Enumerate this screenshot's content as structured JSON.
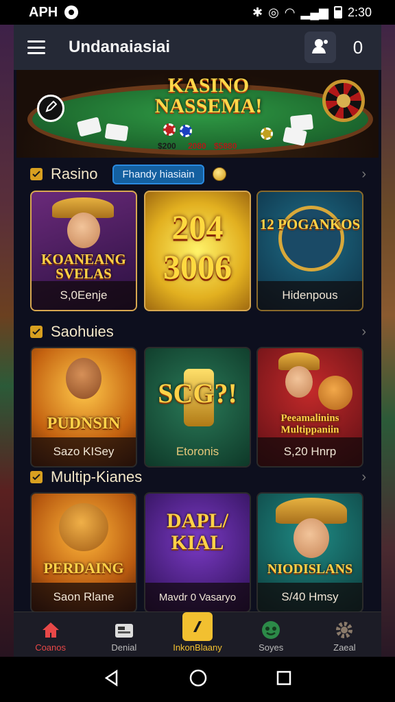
{
  "status_bar": {
    "carrier": "APH",
    "time": "2:30"
  },
  "header": {
    "title": "Undanaiasiai"
  },
  "banner": {
    "title_line1": "KASINO",
    "title_line2": "NASSEMA!",
    "amounts": [
      "$200",
      "2080",
      "$5880"
    ]
  },
  "sections": [
    {
      "title": "Rasino",
      "pill": "Fhandy hiasiain",
      "tiles": [
        {
          "big": "KOANEANG SVELAS",
          "sub": "S,0Eenje"
        },
        {
          "big": "204 3006",
          "sub": ""
        },
        {
          "big": "12 POGANKOS",
          "sub": "Hidenpous"
        }
      ]
    },
    {
      "title": "Saohuies",
      "tiles": [
        {
          "big": "PUDNSIN",
          "sub": "Sazo KISey"
        },
        {
          "big": "SCG?!",
          "sub": "Etoronis"
        },
        {
          "big": "Peeamalinins Multippaniin",
          "sub": "S,20 Hnrp"
        }
      ]
    },
    {
      "title": "Multip-Kianes",
      "tiles": [
        {
          "big": "PERDAING",
          "sub": "Saon Rlane"
        },
        {
          "big": "DAPL/ KIAL",
          "sub": "Mavdr 0 Vasaryo"
        },
        {
          "big": "NIODISLANS",
          "sub": "S/40 Hmsy"
        }
      ]
    }
  ],
  "bottom_nav": [
    "Coanos",
    "Denial",
    "InkonBlaany",
    "Soyes",
    "Zaeal"
  ],
  "colors": {
    "accent": "#f2c030",
    "brand_red": "#e84848",
    "header_bg": "#252936",
    "app_bg": "#0d0f1e"
  }
}
